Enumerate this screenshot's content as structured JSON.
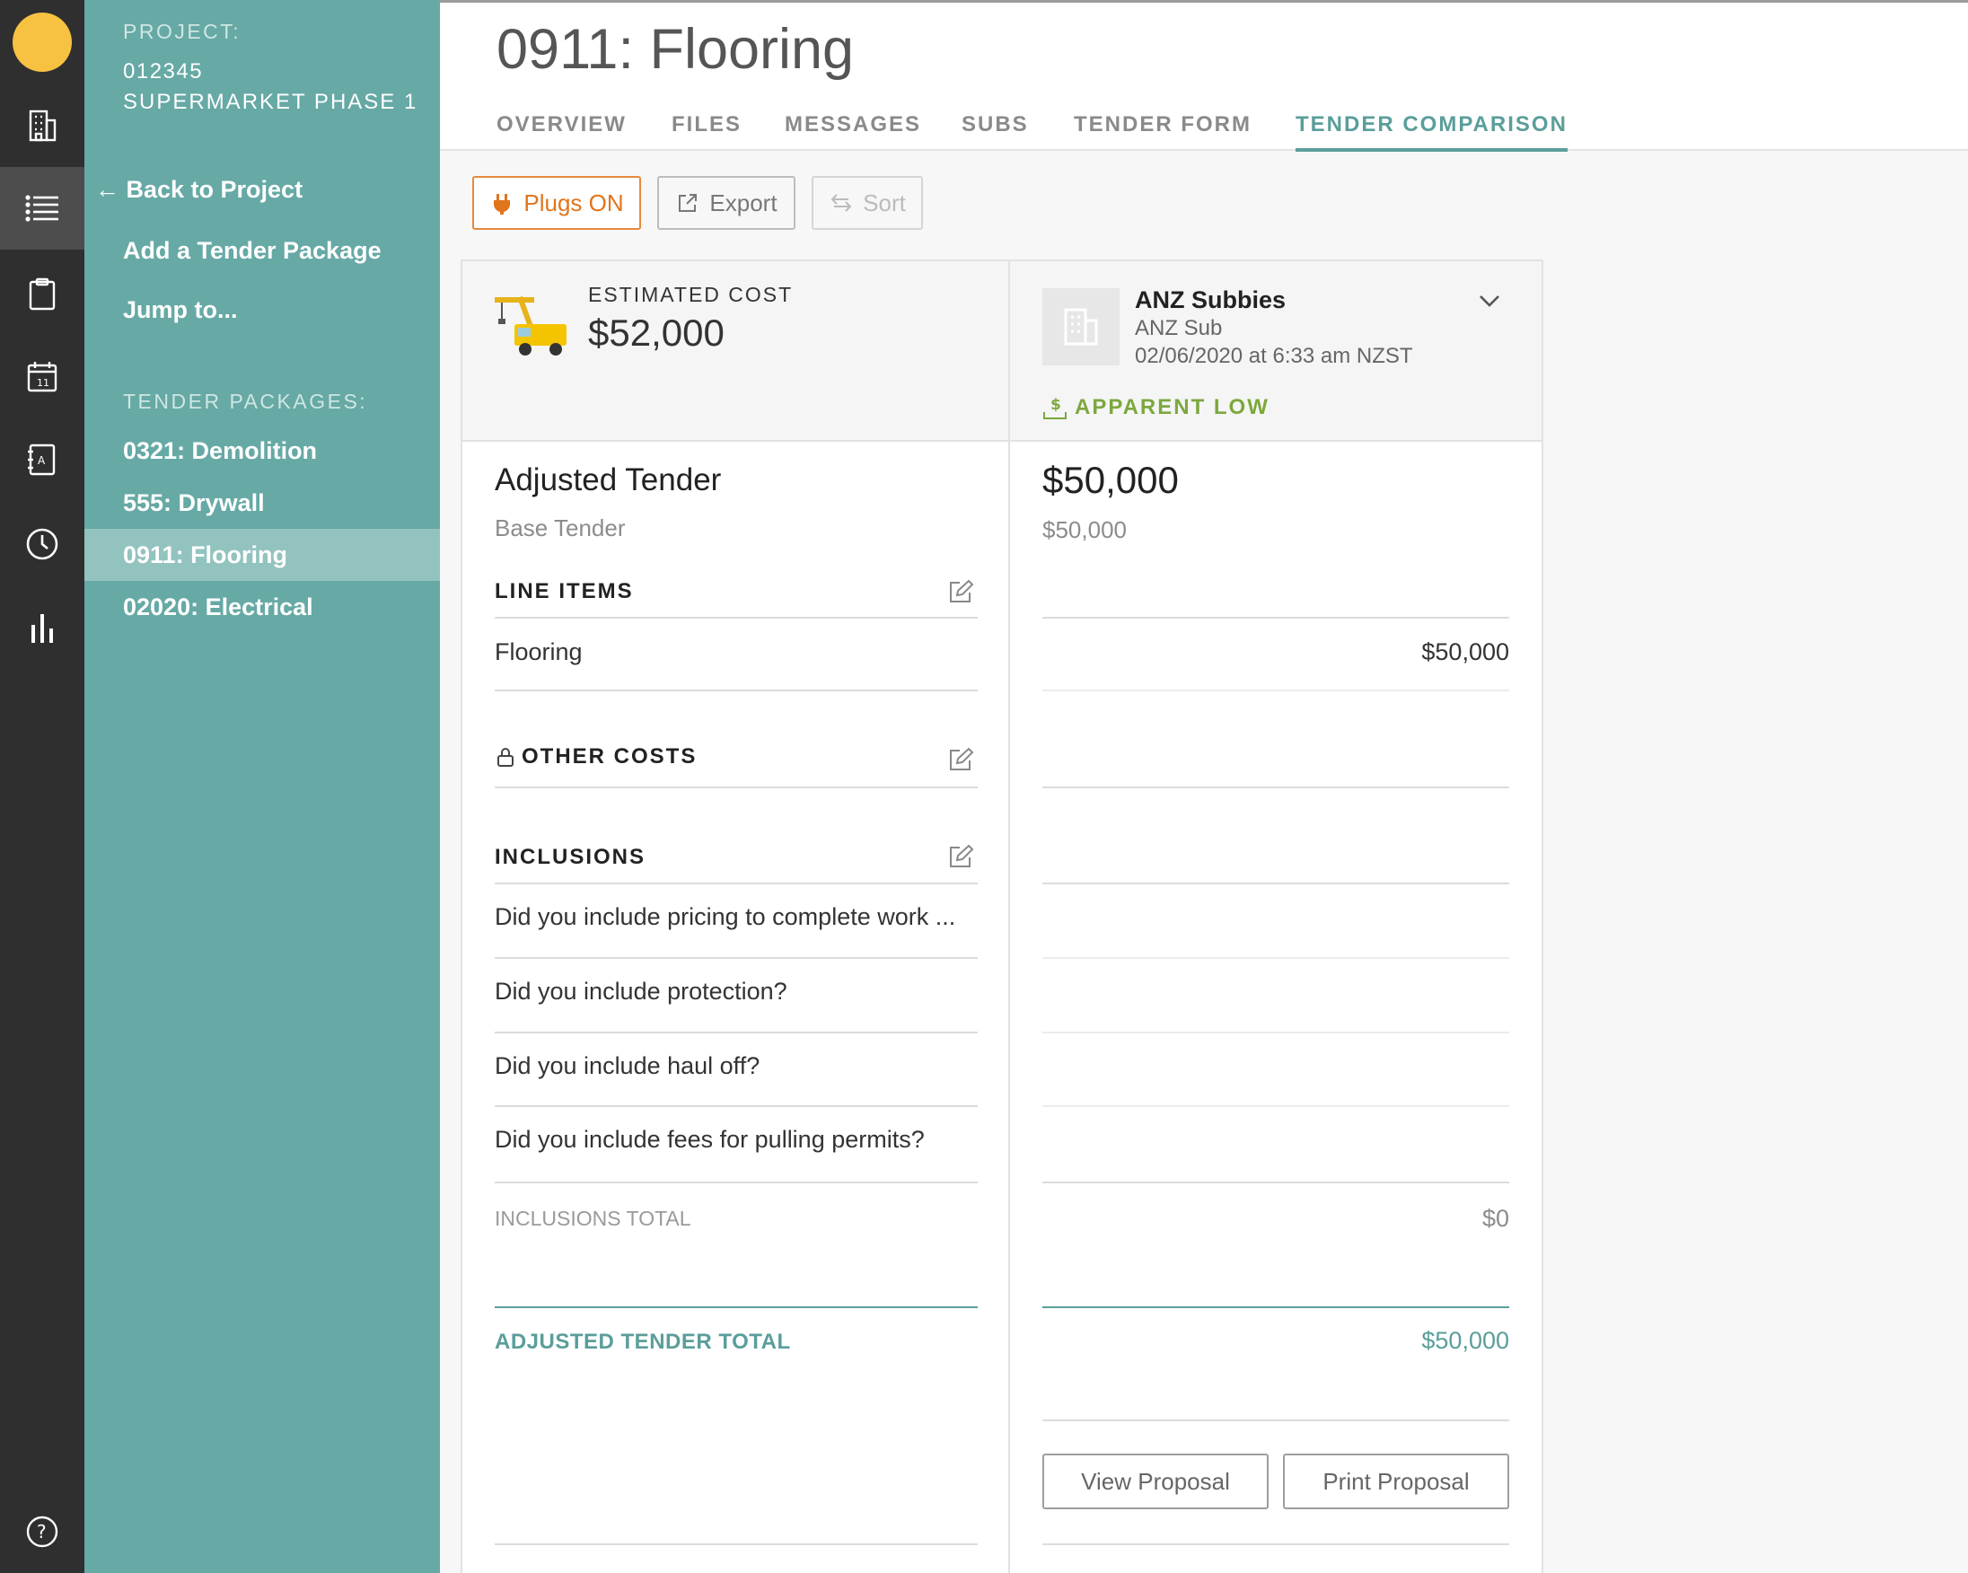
{
  "project": {
    "label": "PROJECT:",
    "number": "012345",
    "name": "SUPERMARKET PHASE 1"
  },
  "sidebar": {
    "back": "← Back to Project",
    "add_package": "Add a Tender Package",
    "jump": "Jump to...",
    "packages_label": "TENDER PACKAGES:",
    "packages": [
      {
        "label": "0321: Demolition"
      },
      {
        "label": "555: Drywall"
      },
      {
        "label": "0911: Flooring"
      },
      {
        "label": "02020: Electrical"
      }
    ]
  },
  "header": {
    "title": "0911: Flooring",
    "tabs": [
      {
        "label": "OVERVIEW"
      },
      {
        "label": "FILES"
      },
      {
        "label": "MESSAGES"
      },
      {
        "label": "SUBS"
      },
      {
        "label": "TENDER FORM"
      },
      {
        "label": "TENDER COMPARISON"
      }
    ]
  },
  "toolbar": {
    "plugs": "Plugs ON",
    "export": "Export",
    "sort": "Sort"
  },
  "estimate": {
    "label": "ESTIMATED COST",
    "value": "$52,000"
  },
  "bidder": {
    "name": "ANZ Subbies",
    "sub": "ANZ Sub",
    "date": "02/06/2020 at 6:33 am NZST",
    "badge": "APPARENT LOW",
    "adjusted": "$50,000",
    "base": "$50,000",
    "line_flooring": "$50,000",
    "inclusions_total": "$0",
    "adjusted_total": "$50,000",
    "view_proposal": "View Proposal",
    "print_proposal": "Print Proposal"
  },
  "labels": {
    "adjusted_tender": "Adjusted Tender",
    "base_tender": "Base Tender",
    "line_items": "LINE ITEMS",
    "flooring": "Flooring",
    "other_costs": "OTHER COSTS",
    "inclusions": "INCLUSIONS",
    "inc_1": "Did you include pricing to complete work ...",
    "inc_2": "Did you include protection?",
    "inc_3": "Did you include haul off?",
    "inc_4": "Did you include fees for pulling permits?",
    "inclusions_total": "INCLUSIONS TOTAL",
    "adjusted_total": "ADJUSTED TENDER TOTAL"
  },
  "colors": {
    "teal": "#66a9a5",
    "accent": "#5a9e9a",
    "orange": "#e0751c",
    "green": "#7ca83d"
  }
}
